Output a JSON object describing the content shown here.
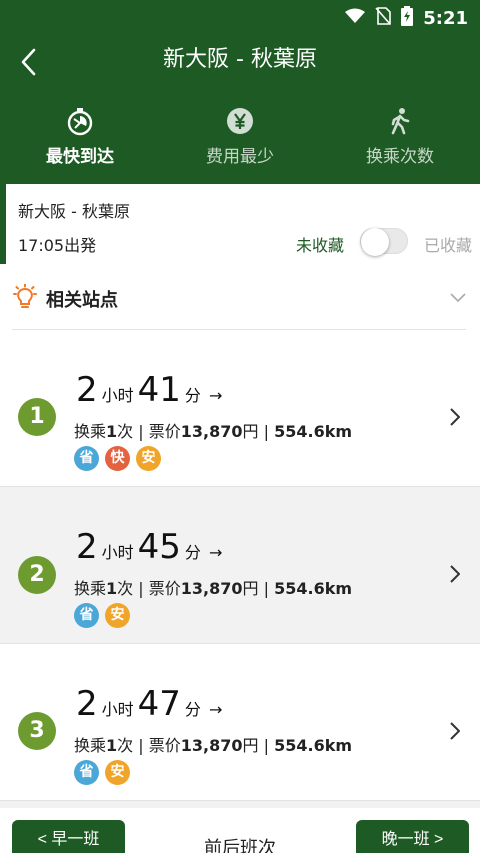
{
  "status_bar": {
    "time": "5:21"
  },
  "header": {
    "title": "新大阪 - 秋葉原"
  },
  "tabs": [
    {
      "label": "最快到达",
      "icon": "stopwatch-icon",
      "active": true
    },
    {
      "label": "费用最少",
      "icon": "yen-icon",
      "active": false
    },
    {
      "label": "换乘次数",
      "icon": "walking-icon",
      "active": false
    }
  ],
  "info": {
    "route": "新大阪 - 秋葉原",
    "departure": "17:05出発",
    "fav_off": "未收藏",
    "fav_on": "已收藏"
  },
  "related": {
    "label": "相关站点"
  },
  "routes": [
    {
      "num": "1",
      "hours": "2",
      "hour_unit": "小时",
      "minutes": "41",
      "minute_unit": "分",
      "arrow": "→",
      "transfer": "换乘",
      "transfer_count": "1",
      "transfer_unit": "次",
      "sep": "|",
      "fare_label": "票价",
      "fare": "13,870",
      "fare_unit": "円",
      "distance": "554.6km",
      "badges": [
        "省",
        "快",
        "安"
      ]
    },
    {
      "num": "2",
      "hours": "2",
      "hour_unit": "小时",
      "minutes": "45",
      "minute_unit": "分",
      "arrow": "→",
      "transfer": "换乘",
      "transfer_count": "1",
      "transfer_unit": "次",
      "sep": "|",
      "fare_label": "票价",
      "fare": "13,870",
      "fare_unit": "円",
      "distance": "554.6km",
      "badges": [
        "省",
        "安"
      ]
    },
    {
      "num": "3",
      "hours": "2",
      "hour_unit": "小时",
      "minutes": "47",
      "minute_unit": "分",
      "arrow": "→",
      "transfer": "换乘",
      "transfer_count": "1",
      "transfer_unit": "次",
      "sep": "|",
      "fare_label": "票价",
      "fare": "13,870",
      "fare_unit": "円",
      "distance": "554.6km",
      "badges": [
        "省",
        "安"
      ]
    }
  ],
  "bottom": {
    "prev": "< 早一班",
    "middle": "前后班次",
    "next": "晚一班 >"
  },
  "colors": {
    "primary": "#1e5a24",
    "number": "#6d9b2f",
    "badge_sheng": "#4aa7d8",
    "badge_kuai": "#e4623f",
    "badge_an": "#f0a52a"
  }
}
